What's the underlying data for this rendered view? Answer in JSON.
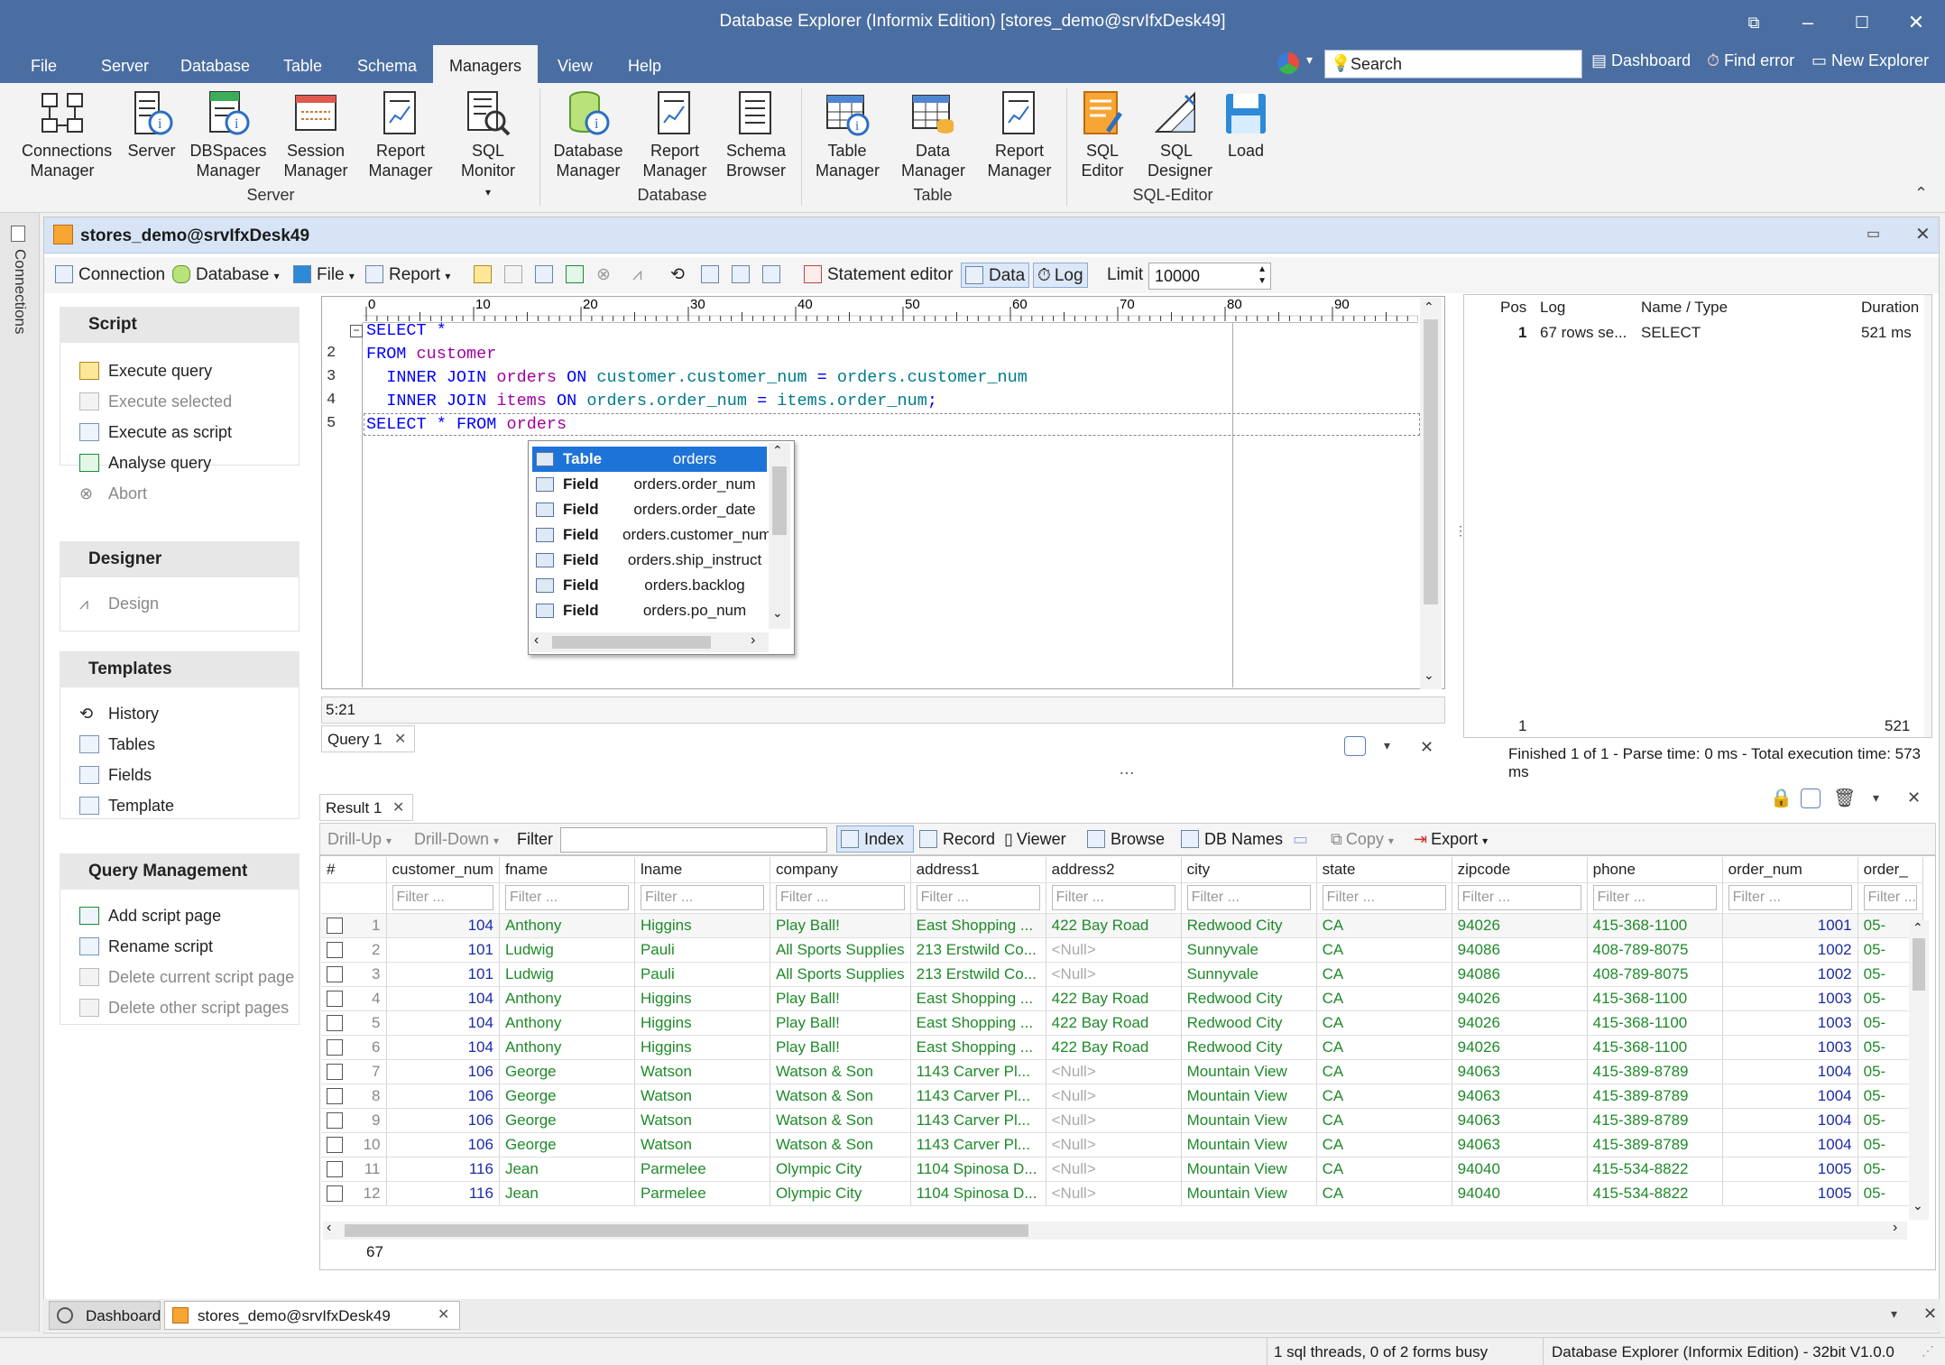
{
  "window": {
    "title": "Database Explorer (Informix Edition) [stores_demo@srvIfxDesk49]"
  },
  "menu": [
    "File",
    "Server",
    "Database",
    "Table",
    "Schema",
    "Managers",
    "View",
    "Help"
  ],
  "search": {
    "placeholder": "Search"
  },
  "toplinks": {
    "dashboard": "Dashboard",
    "find_error": "Find error",
    "new_explorer": "New Explorer"
  },
  "ribbon": {
    "connections": "Connections Manager",
    "server": "Server",
    "dbspaces": "DBSpaces Manager",
    "session": "Session Manager",
    "report1": "Report Manager",
    "sqlmonitor": "SQL Monitor",
    "group_server": "Server",
    "dbmanager": "Database Manager",
    "report2": "Report Manager",
    "schema": "Schema Browser",
    "group_database": "Database",
    "tablemanager": "Table Manager",
    "datamanager": "Data Manager",
    "report3": "Report Manager",
    "group_table": "Table",
    "sqleditor": "SQL Editor",
    "sqldesigner": "SQL Designer",
    "load": "Load",
    "group_sqleditor": "SQL-Editor"
  },
  "leftstrip": {
    "label": "Connections"
  },
  "doc": {
    "title": "stores_demo@srvIfxDesk49"
  },
  "toolbar": {
    "connection": "Connection",
    "database": "Database",
    "file": "File",
    "report": "Report",
    "statement_editor": "Statement editor",
    "data": "Data",
    "log": "Log",
    "limit_label": "Limit",
    "limit_value": "10000"
  },
  "panel": {
    "script": {
      "title": "Script",
      "items": [
        "Execute query",
        "Execute selected",
        "Execute as script",
        "Analyse query",
        "Abort"
      ]
    },
    "designer": {
      "title": "Designer",
      "items": [
        "Design"
      ]
    },
    "templates": {
      "title": "Templates",
      "items": [
        "History",
        "Tables",
        "Fields",
        "Template"
      ]
    },
    "qm": {
      "title": "Query Management",
      "items": [
        "Add script page",
        "Rename script",
        "Delete current script page",
        "Delete other script pages"
      ]
    }
  },
  "editor": {
    "ruler": [
      "0",
      "10",
      "20",
      "30",
      "40",
      "50",
      "60",
      "70",
      "80",
      "90"
    ],
    "line_numbers": [
      "2",
      "3",
      "4",
      "5"
    ],
    "position": "5:21",
    "tab": "Query 1"
  },
  "autocomplete": [
    {
      "kind": "Table",
      "value": "orders"
    },
    {
      "kind": "Field",
      "value": "orders.order_num"
    },
    {
      "kind": "Field",
      "value": "orders.order_date"
    },
    {
      "kind": "Field",
      "value": "orders.customer_num"
    },
    {
      "kind": "Field",
      "value": "orders.ship_instruct"
    },
    {
      "kind": "Field",
      "value": "orders.backlog"
    },
    {
      "kind": "Field",
      "value": "orders.po_num"
    }
  ],
  "log": {
    "headers": {
      "pos": "Pos",
      "log": "Log",
      "name": "Name / Type",
      "duration": "Duration"
    },
    "row": {
      "pos": "1",
      "log": "67 rows se...",
      "name": "SELECT",
      "duration": "521 ms"
    },
    "footer_left": "1",
    "footer_right": "521",
    "finished": "Finished 1 of 1 - Parse time: 0 ms - Total execution time: 573 ms"
  },
  "result": {
    "tab": "Result 1",
    "toolbar": {
      "drillup": "Drill-Up",
      "drilldown": "Drill-Down",
      "filter": "Filter",
      "index": "Index",
      "record": "Record",
      "viewer": "Viewer",
      "browse": "Browse",
      "dbnames": "DB Names",
      "copy": "Copy",
      "export": "Export"
    },
    "filter_placeholder": "Filter ...",
    "columns": [
      "#",
      "customer_num",
      "fname",
      "lname",
      "company",
      "address1",
      "address2",
      "city",
      "state",
      "zipcode",
      "phone",
      "order_num",
      "order_"
    ],
    "rows": [
      [
        "1",
        "104",
        "Anthony",
        "Higgins",
        "Play Ball!",
        "East Shopping ...",
        "422 Bay Road",
        "Redwood City",
        "CA",
        "94026",
        "415-368-1100",
        "1001",
        "05-"
      ],
      [
        "2",
        "101",
        "Ludwig",
        "Pauli",
        "All Sports Supplies",
        "213 Erstwild Co...",
        "<Null>",
        "Sunnyvale",
        "CA",
        "94086",
        "408-789-8075",
        "1002",
        "05-"
      ],
      [
        "3",
        "101",
        "Ludwig",
        "Pauli",
        "All Sports Supplies",
        "213 Erstwild Co...",
        "<Null>",
        "Sunnyvale",
        "CA",
        "94086",
        "408-789-8075",
        "1002",
        "05-"
      ],
      [
        "4",
        "104",
        "Anthony",
        "Higgins",
        "Play Ball!",
        "East Shopping ...",
        "422 Bay Road",
        "Redwood City",
        "CA",
        "94026",
        "415-368-1100",
        "1003",
        "05-"
      ],
      [
        "5",
        "104",
        "Anthony",
        "Higgins",
        "Play Ball!",
        "East Shopping ...",
        "422 Bay Road",
        "Redwood City",
        "CA",
        "94026",
        "415-368-1100",
        "1003",
        "05-"
      ],
      [
        "6",
        "104",
        "Anthony",
        "Higgins",
        "Play Ball!",
        "East Shopping ...",
        "422 Bay Road",
        "Redwood City",
        "CA",
        "94026",
        "415-368-1100",
        "1003",
        "05-"
      ],
      [
        "7",
        "106",
        "George",
        "Watson",
        "Watson & Son",
        "1143 Carver Pl...",
        "<Null>",
        "Mountain View",
        "CA",
        "94063",
        "415-389-8789",
        "1004",
        "05-"
      ],
      [
        "8",
        "106",
        "George",
        "Watson",
        "Watson & Son",
        "1143 Carver Pl...",
        "<Null>",
        "Mountain View",
        "CA",
        "94063",
        "415-389-8789",
        "1004",
        "05-"
      ],
      [
        "9",
        "106",
        "George",
        "Watson",
        "Watson & Son",
        "1143 Carver Pl...",
        "<Null>",
        "Mountain View",
        "CA",
        "94063",
        "415-389-8789",
        "1004",
        "05-"
      ],
      [
        "10",
        "106",
        "George",
        "Watson",
        "Watson & Son",
        "1143 Carver Pl...",
        "<Null>",
        "Mountain View",
        "CA",
        "94063",
        "415-389-8789",
        "1004",
        "05-"
      ],
      [
        "11",
        "116",
        "Jean",
        "Parmelee",
        "Olympic City",
        "1104 Spinosa D...",
        "<Null>",
        "Mountain View",
        "CA",
        "94040",
        "415-534-8822",
        "1005",
        "05-"
      ],
      [
        "12",
        "116",
        "Jean",
        "Parmelee",
        "Olympic City",
        "1104 Spinosa D...",
        "<Null>",
        "Mountain View",
        "CA",
        "94040",
        "415-534-8822",
        "1005",
        "05-"
      ]
    ],
    "count": "67"
  },
  "bottomtabs": {
    "dashboard": "Dashboard",
    "doc": "stores_demo@srvIfxDesk49"
  },
  "status": {
    "threads": "1 sql threads, 0 of 2 forms busy",
    "app": "Database Explorer (Informix Edition) - 32bit V1.0.0"
  }
}
